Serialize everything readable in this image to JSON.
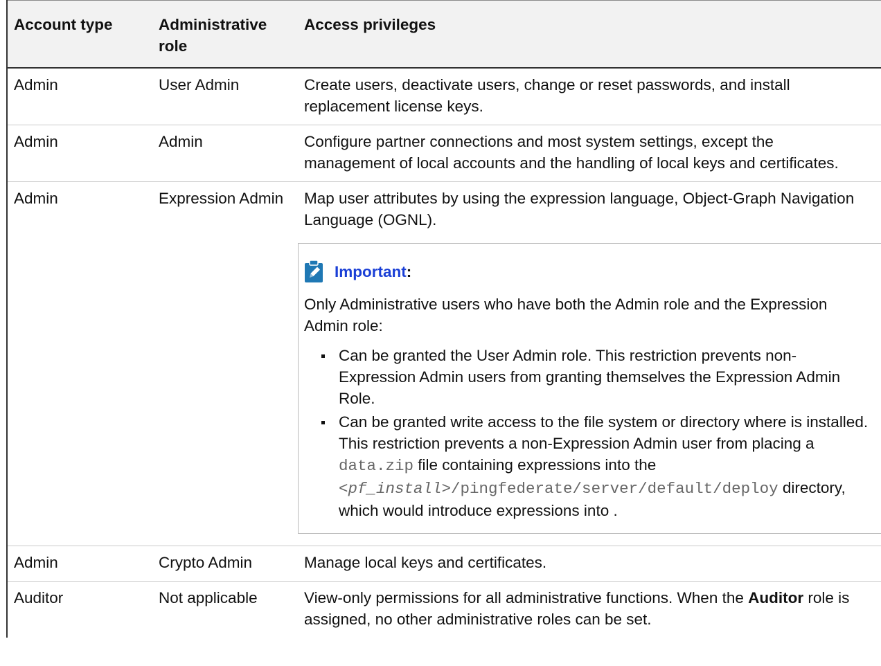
{
  "table": {
    "headers": [
      "Account type",
      "Administrative role",
      "Access privileges"
    ],
    "rows": [
      {
        "account_type": "Admin",
        "role": "User Admin",
        "privileges": "Create users, deactivate users, change or reset passwords, and install replacement license keys."
      },
      {
        "account_type": "Admin",
        "role": "Admin",
        "privileges": "Configure partner connections and most system settings, except the management of local accounts and the handling of local keys and certificates."
      },
      {
        "account_type": "Admin",
        "role": "Expression Admin",
        "privileges": "Map user attributes by using the expression language, Object-Graph Navigation Language (OGNL).",
        "note": {
          "title": "Important",
          "colon": ":",
          "icon": "pencil-note-icon",
          "intro": "Only Administrative users who have both the Admin role and the Expression Admin role:",
          "bullets": {
            "b1": "Can be granted the User Admin role. This restriction prevents non-Expression Admin users from granting themselves the Expression Admin Role.",
            "b2_part1": "Can be granted write access to the file system or directory where is installed. This restriction prevents a non-Expression Admin user from placing a ",
            "b2_code1": "data.zip",
            "b2_part2": " file containing expressions into the ",
            "b2_code_var": "<pf_install>",
            "b2_code2": "/pingfederate/server/default/deploy",
            "b2_part3": " directory, which would introduce expressions into ."
          }
        }
      },
      {
        "account_type": "Admin",
        "role": "Crypto Admin",
        "privileges": "Manage local keys and certificates."
      },
      {
        "account_type": "Auditor",
        "role": "Not applicable",
        "privileges_part1": "View-only permissions for all administrative functions. When the ",
        "privileges_bold": "Auditor",
        "privileges_part2": " role is assigned, no other administrative roles can be set."
      }
    ]
  },
  "colors": {
    "header_bg": "#f2f2f2",
    "link_blue": "#1a3fd6",
    "icon_blue": "#1f78b4",
    "code_gray": "#666666"
  }
}
